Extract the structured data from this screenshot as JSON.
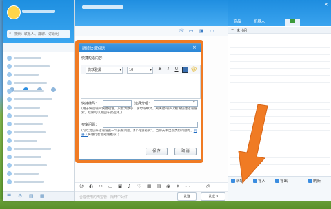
{
  "qq": {
    "search_placeholder": "搜索：联系人、群聊、讨论组"
  },
  "chat": {
    "hint": "合理使用的陶宝管：隔开中公仔",
    "send_label": "发送",
    "send_menu_label": "发送 ▾",
    "close_label": "关闭"
  },
  "right_panel": {
    "tabs": [
      "商品",
      "机器人",
      ""
    ],
    "group_label": "未分组",
    "footer": {
      "add": "新增",
      "import": "导入",
      "export": "导出",
      "refresh": "刷新"
    }
  },
  "dialog": {
    "title": "新增快捷短语",
    "content_label": "快捷短语内容：",
    "font_name": "微软雅黑",
    "font_size": "10",
    "bold": "B",
    "italic": "I",
    "underline": "U",
    "shortcut_label": "快捷编码：",
    "group_label": "选择分组：",
    "desc1": "(用于快速输入快捷短语，只能为数字、字母或中文，刷关键(输入)/触发快捷短语搜索，结果可以用回车键选择。)",
    "keyword_label": "买家问题：",
    "desc2_prefix": "(可以为该条短语设置一个买家问题，如“有没有货”，当聊天中出现类似问题时，",
    "desc2_link": "机器人",
    "desc2_suffix": "将进行智能短语推荐。)",
    "save_label": "保 存",
    "cancel_label": "取 消"
  },
  "colors": {
    "qq_blue": "#1e8fe0",
    "dialog_highlight": "#f07b24",
    "arrow": "#f07b24"
  }
}
